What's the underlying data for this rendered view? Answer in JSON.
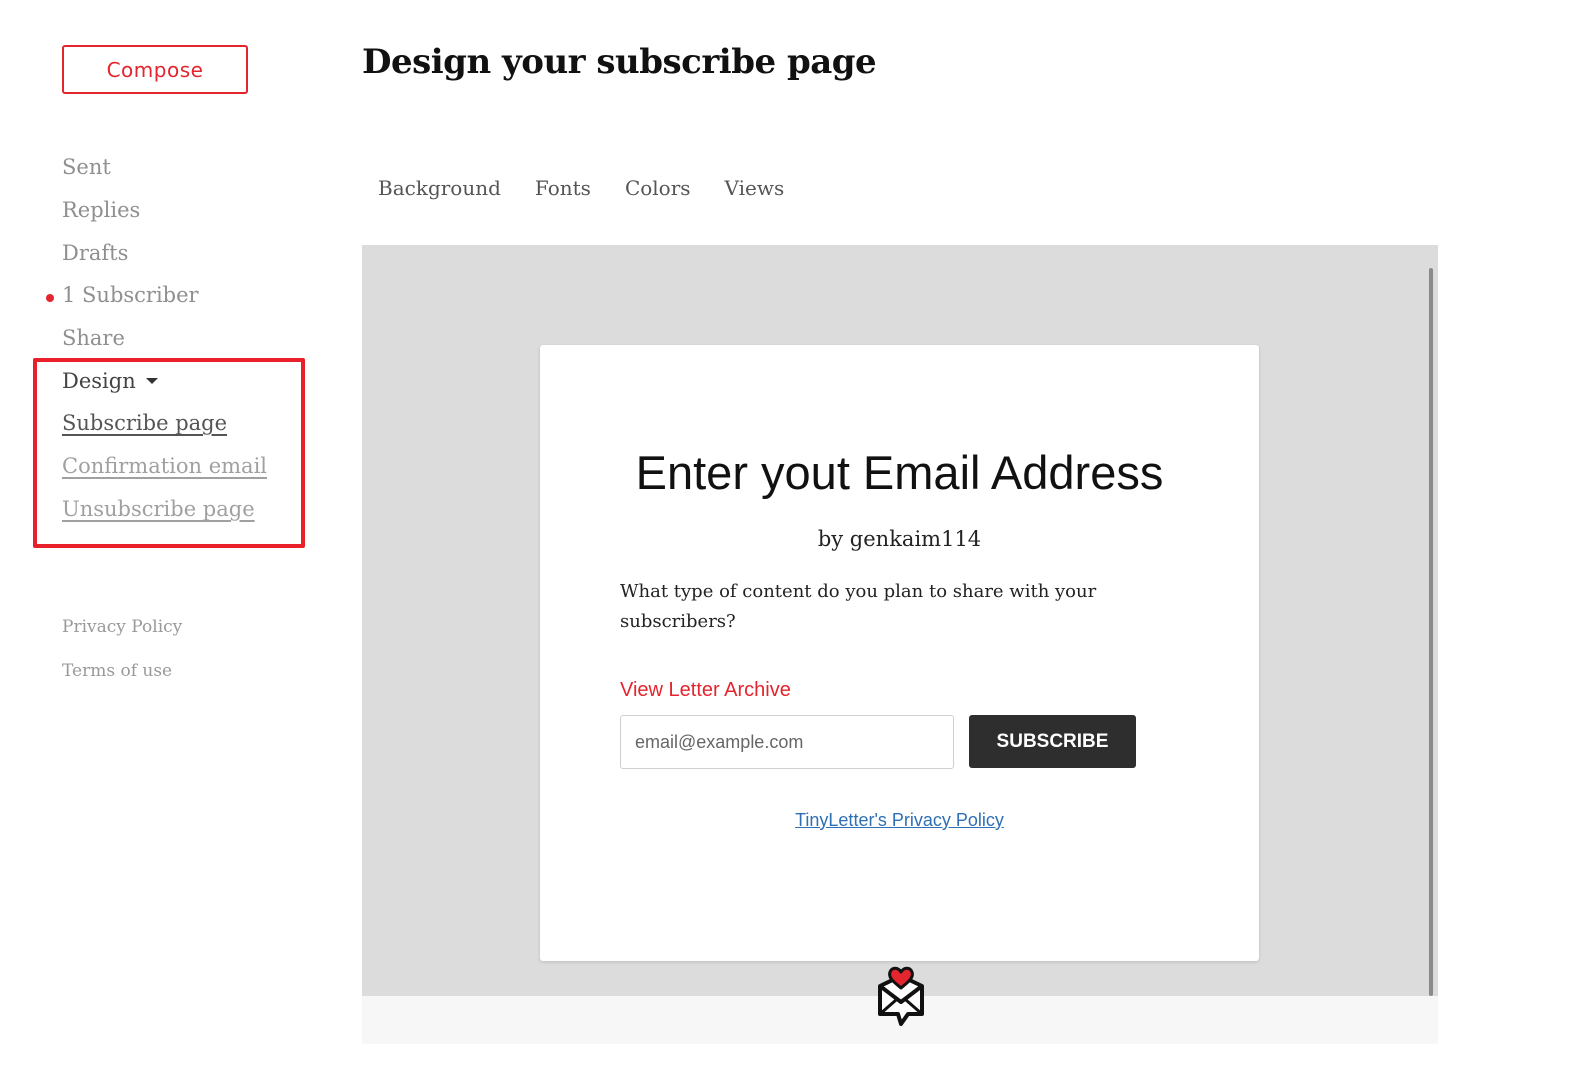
{
  "sidebar": {
    "compose_label": "Compose",
    "items": [
      {
        "label": "Sent"
      },
      {
        "label": "Replies"
      },
      {
        "label": "Drafts"
      },
      {
        "label": "1 Subscriber"
      },
      {
        "label": "Share"
      }
    ],
    "design": {
      "label": "Design",
      "subitems": [
        {
          "label": "Subscribe page",
          "active": true
        },
        {
          "label": "Confirmation email",
          "active": false
        },
        {
          "label": "Unsubscribe page",
          "active": false
        }
      ]
    },
    "footer_links": [
      {
        "label": "Privacy Policy"
      },
      {
        "label": "Terms of use"
      }
    ]
  },
  "main": {
    "title": "Design your subscribe page",
    "tabs": [
      {
        "label": "Background"
      },
      {
        "label": "Fonts"
      },
      {
        "label": "Colors"
      },
      {
        "label": "Views"
      }
    ]
  },
  "preview": {
    "heading": "Enter yout Email Address",
    "byline": "by genkaim114",
    "description": "What type of content do you plan to share with your subscribers?",
    "archive_link": "View Letter Archive",
    "email_placeholder": "email@example.com",
    "subscribe_label": "SUBSCRIBE",
    "privacy_link": "TinyLetter's Privacy Policy"
  },
  "colors": {
    "accent": "#e4252d",
    "preview_bg": "#dcdcdc",
    "button_bg": "#2e2e2e",
    "link_blue": "#2f6fb5"
  },
  "icons": {
    "logo": "tinyletter-heart-envelope-icon",
    "notification_dot": "red-dot-icon",
    "dropdown": "caret-down-icon"
  }
}
